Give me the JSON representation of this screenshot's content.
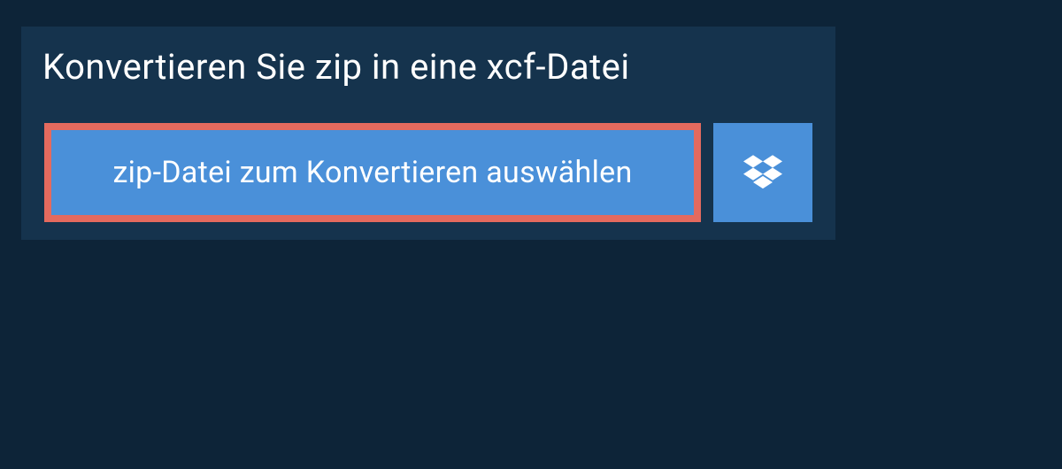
{
  "header": {
    "title": "Konvertieren Sie zip in eine xcf-Datei"
  },
  "upload": {
    "select_file_label": "zip-Datei zum Konvertieren auswählen"
  }
}
